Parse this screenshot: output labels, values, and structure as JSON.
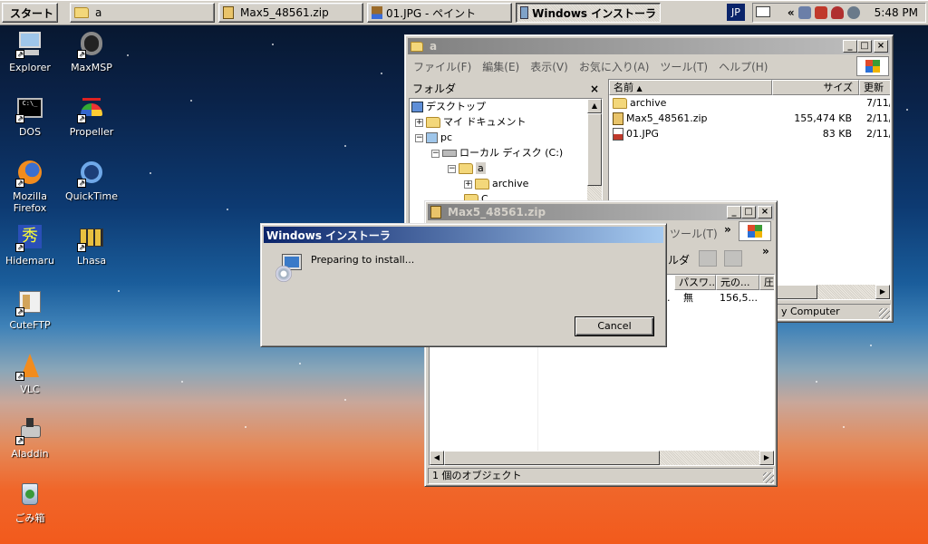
{
  "taskbar": {
    "start_label": "スタート",
    "tasks": [
      {
        "label": "a"
      },
      {
        "label": "Max5_48561.zip"
      },
      {
        "label": "01.JPG - ペイント"
      },
      {
        "label": "Windows インストーラ"
      }
    ],
    "lang": "JP",
    "clock": "5:48 PM"
  },
  "desktop_icons": [
    {
      "label": "Explorer"
    },
    {
      "label": "MaxMSP"
    },
    {
      "label": "DOS"
    },
    {
      "label": "Propeller"
    },
    {
      "label": "Mozilla Firefox"
    },
    {
      "label": "QuickTime"
    },
    {
      "label": "Hidemaru"
    },
    {
      "label": "Lhasa"
    },
    {
      "label": "CuteFTP"
    },
    {
      "label": "VLC"
    },
    {
      "label": "Aladdin"
    },
    {
      "label": "ごみ箱"
    }
  ],
  "explorer": {
    "title": "a",
    "menu": [
      "ファイル(F)",
      "編集(E)",
      "表示(V)",
      "お気に入り(A)",
      "ツール(T)",
      "ヘルプ(H)"
    ],
    "folders_label": "フォルダ",
    "tree": [
      {
        "label": "デスクトップ"
      },
      {
        "label": "マイ ドキュメント"
      },
      {
        "label": "pc"
      },
      {
        "label": "ローカル ディスク (C:)"
      },
      {
        "label": "a"
      },
      {
        "label": "archive"
      },
      {
        "label": "C..."
      }
    ],
    "columns": {
      "name": "名前",
      "size": "サイズ",
      "date": "更新"
    },
    "files": [
      {
        "name": "archive",
        "size": "",
        "date": "7/11/"
      },
      {
        "name": "Max5_48561.zip",
        "size": "155,474 KB",
        "date": "2/11/"
      },
      {
        "name": "01.JPG",
        "size": "83 KB",
        "date": "2/11/"
      }
    ],
    "status": "y Computer"
  },
  "zip_window": {
    "title": "Max5_48561.zip",
    "menu_partial": "ツール(T)",
    "toolbar_partial": "ルダ",
    "columns": {
      "password": "パスワ...",
      "original": "元の...",
      "ratio": "圧"
    },
    "row": {
      "mark": ".",
      "password": "無",
      "original": "156,5..."
    },
    "status": "1 個のオブジェクト"
  },
  "installer_dialog": {
    "title": "Windows インストーラ",
    "message": "Preparing to install...",
    "cancel_label": "Cancel"
  }
}
